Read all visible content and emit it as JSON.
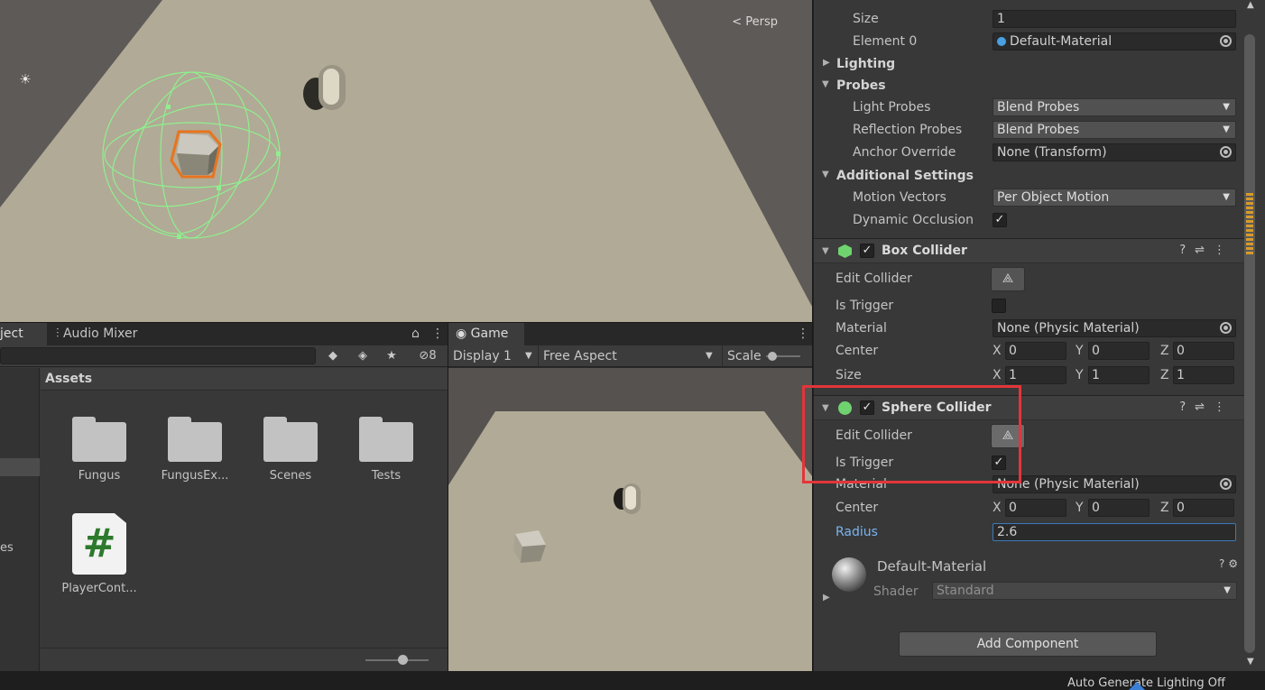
{
  "scene": {
    "persp_label": "Persp"
  },
  "project": {
    "tabs": [
      "ject",
      "Audio Mixer"
    ],
    "toolbar_badge": "8",
    "sidebar_partial": "es",
    "assets_header": "Assets",
    "assets": [
      {
        "name": "Fungus",
        "type": "folder"
      },
      {
        "name": "FungusEx...",
        "type": "folder"
      },
      {
        "name": "Scenes",
        "type": "folder"
      },
      {
        "name": "Tests",
        "type": "folder"
      },
      {
        "name": "PlayerCont...",
        "type": "script",
        "glyph": "#"
      }
    ]
  },
  "game": {
    "tab": "Game",
    "display": "Display 1",
    "aspect": "Free Aspect",
    "scale_label": "Scale"
  },
  "inspector": {
    "materials": {
      "size_label": "Size",
      "size_value": "1",
      "element_label": "Element 0",
      "element_value": "Default-Material"
    },
    "lighting": "Lighting",
    "probes": {
      "title": "Probes",
      "light_label": "Light Probes",
      "light_value": "Blend Probes",
      "reflection_label": "Reflection Probes",
      "reflection_value": "Blend Probes",
      "anchor_label": "Anchor Override",
      "anchor_value": "None (Transform)"
    },
    "additional": {
      "title": "Additional Settings",
      "motion_label": "Motion Vectors",
      "motion_value": "Per Object Motion",
      "dynocc_label": "Dynamic Occlusion",
      "dynocc_checked": true
    },
    "box_collider": {
      "title": "Box Collider",
      "edit_label": "Edit Collider",
      "trigger_label": "Is Trigger",
      "trigger_checked": false,
      "material_label": "Material",
      "material_value": "None (Physic Material)",
      "center_label": "Center",
      "center": [
        "0",
        "0",
        "0"
      ],
      "size_label": "Size",
      "size": [
        "1",
        "1",
        "1"
      ]
    },
    "sphere_collider": {
      "title": "Sphere Collider",
      "edit_label": "Edit Collider",
      "trigger_label": "Is Trigger",
      "trigger_checked": true,
      "material_label": "Material",
      "material_value": "None (Physic Material)",
      "center_label": "Center",
      "center": [
        "0",
        "0",
        "0"
      ],
      "radius_label": "Radius",
      "radius_value": "2.6"
    },
    "material_asset": {
      "name": "Default-Material",
      "shader_label": "Shader",
      "shader_value": "Standard"
    },
    "add_component": "Add Component",
    "axis_labels": [
      "X",
      "Y",
      "Z"
    ]
  },
  "status": {
    "text": "Auto Generate Lighting Off"
  },
  "colors": {
    "highlight": "#e3353a",
    "accent_blue": "#3a79bb",
    "collider_green": "#8ef08e",
    "selection_orange": "#e8741e"
  }
}
